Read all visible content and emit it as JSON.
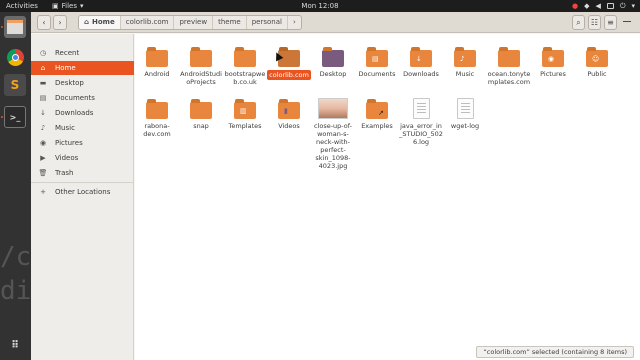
{
  "topbar": {
    "activities": "Activities",
    "app_name": "Files",
    "clock": "Mon 12:08"
  },
  "header": {
    "nav_back": "‹",
    "nav_forward": "›",
    "search": "⌕",
    "view": "☷",
    "menu": "≡"
  },
  "breadcrumbs": [
    {
      "label": "Home",
      "active": true
    },
    {
      "label": "colorlib.com"
    },
    {
      "label": "preview"
    },
    {
      "label": "theme"
    },
    {
      "label": "personal"
    }
  ],
  "sidebar": {
    "items": [
      {
        "label": "Recent",
        "icon": "clock-icon"
      },
      {
        "label": "Home",
        "icon": "home-icon",
        "active": true
      },
      {
        "label": "Desktop",
        "icon": "desktop-icon"
      },
      {
        "label": "Documents",
        "icon": "documents-icon"
      },
      {
        "label": "Downloads",
        "icon": "downloads-icon"
      },
      {
        "label": "Music",
        "icon": "music-icon"
      },
      {
        "label": "Pictures",
        "icon": "pictures-icon"
      },
      {
        "label": "Videos",
        "icon": "videos-icon"
      },
      {
        "label": "Trash",
        "icon": "trash-icon"
      },
      {
        "label": "Other Locations",
        "icon": "plus-icon"
      }
    ]
  },
  "files": [
    {
      "label": "Android",
      "type": "folder"
    },
    {
      "label": "AndroidStudioProjects",
      "type": "folder"
    },
    {
      "label": "bootstrapweb.co.uk",
      "type": "folder"
    },
    {
      "label": "colorlib.com",
      "type": "folder",
      "selected": true
    },
    {
      "label": "Desktop",
      "type": "folder-desktop"
    },
    {
      "label": "Documents",
      "type": "folder-docs"
    },
    {
      "label": "Downloads",
      "type": "folder-dl"
    },
    {
      "label": "Music",
      "type": "folder-music"
    },
    {
      "label": "ocean.tonytemplates.com",
      "type": "folder"
    },
    {
      "label": "Pictures",
      "type": "folder-pics"
    },
    {
      "label": "Public",
      "type": "folder-public"
    },
    {
      "label": "rabona-dev.com",
      "type": "folder"
    },
    {
      "label": "snap",
      "type": "folder"
    },
    {
      "label": "Templates",
      "type": "folder-templates"
    },
    {
      "label": "Videos",
      "type": "folder-videos"
    },
    {
      "label": "close-up-of-woman-s-neck-with-perfect-skin_1098-4023.jpg",
      "type": "image"
    },
    {
      "label": "Examples",
      "type": "folder-link"
    },
    {
      "label": "java_error_in_STUDIO_5026.log",
      "type": "document"
    },
    {
      "label": "wget-log",
      "type": "document"
    }
  ],
  "status": "“colorlib.com” selected (containing 8 items)",
  "colors": {
    "accent": "#e95420",
    "folder": "#e8863e"
  }
}
